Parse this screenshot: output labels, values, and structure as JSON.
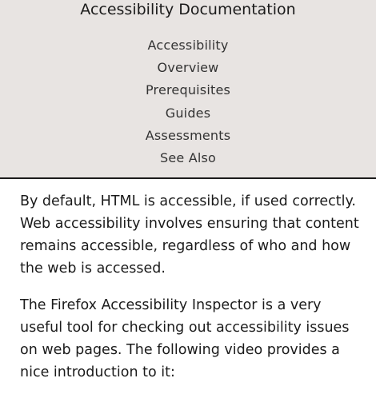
{
  "sidebar": {
    "title": "Accessibility Documentation",
    "items": [
      {
        "label": "Accessibility"
      },
      {
        "label": "Overview"
      },
      {
        "label": "Prerequisites"
      },
      {
        "label": "Guides"
      },
      {
        "label": "Assessments"
      },
      {
        "label": "See Also"
      }
    ]
  },
  "main": {
    "paragraphs": [
      "By default, HTML is accessible, if used correctly. Web accessibility involves ensuring that content remains accessible, regardless of who and how the web is accessed.",
      "The Firefox Accessibility Inspector is a very useful tool for checking out accessibility issues on web pages. The following video provides a nice introduction to it:"
    ]
  }
}
